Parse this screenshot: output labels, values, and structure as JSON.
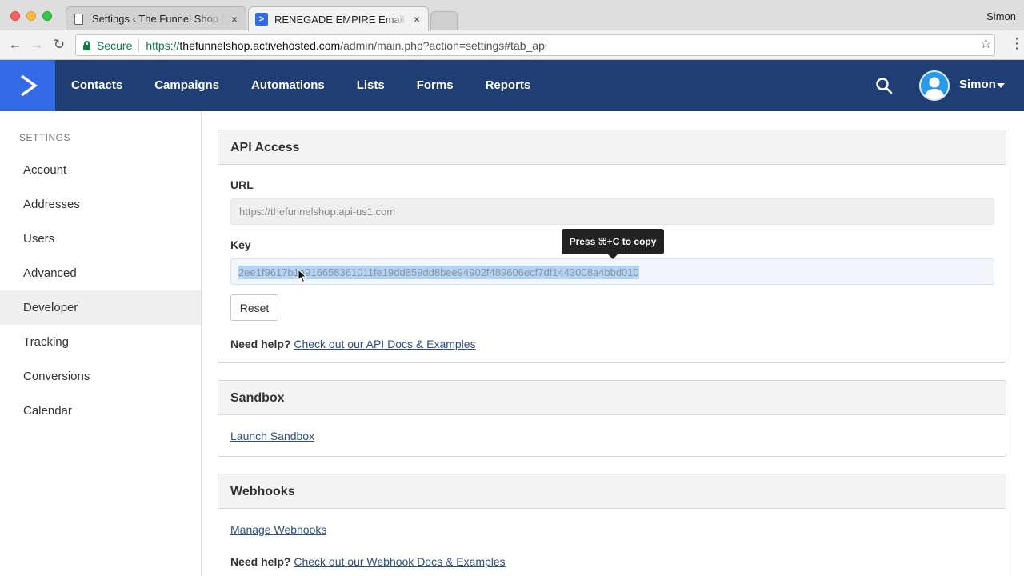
{
  "browser": {
    "tabs": [
      {
        "title": "Settings ‹ The Funnel Shop Design",
        "close": "×"
      },
      {
        "title": "RENEGADE EMPIRE Email Marketing",
        "close": "×"
      }
    ],
    "user": "Simon",
    "secure_label": "Secure",
    "url_scheme": "https://",
    "url_host": "thefunnelshop.activehosted.com",
    "url_path": "/admin/main.php?action=settings#tab_api"
  },
  "nav": {
    "items": [
      "Contacts",
      "Campaigns",
      "Automations",
      "Lists",
      "Forms",
      "Reports"
    ],
    "user": "Simon",
    "brand_color": "#356ae6",
    "bar_color": "#1f3e73"
  },
  "sidebar": {
    "heading": "SETTINGS",
    "items": [
      "Account",
      "Addresses",
      "Users",
      "Advanced",
      "Developer",
      "Tracking",
      "Conversions",
      "Calendar"
    ],
    "active": "Developer"
  },
  "api": {
    "title": "API Access",
    "url_label": "URL",
    "url_value": "https://thefunnelshop.api-us1.com",
    "key_label": "Key",
    "key_value": "2ee1f9617b1a916658361011fe19dd859dd8bee94902f489606ecf7df1443008a4bbd010",
    "tooltip": "Press ⌘+C to copy",
    "reset_label": "Reset",
    "help_prefix": "Need help?",
    "help_link": "Check out our API Docs & Examples"
  },
  "sandbox": {
    "title": "Sandbox",
    "link": "Launch Sandbox"
  },
  "webhooks": {
    "title": "Webhooks",
    "link": "Manage Webhooks",
    "help_prefix": "Need help?",
    "help_link": "Check out our Webhook Docs & Examples"
  }
}
